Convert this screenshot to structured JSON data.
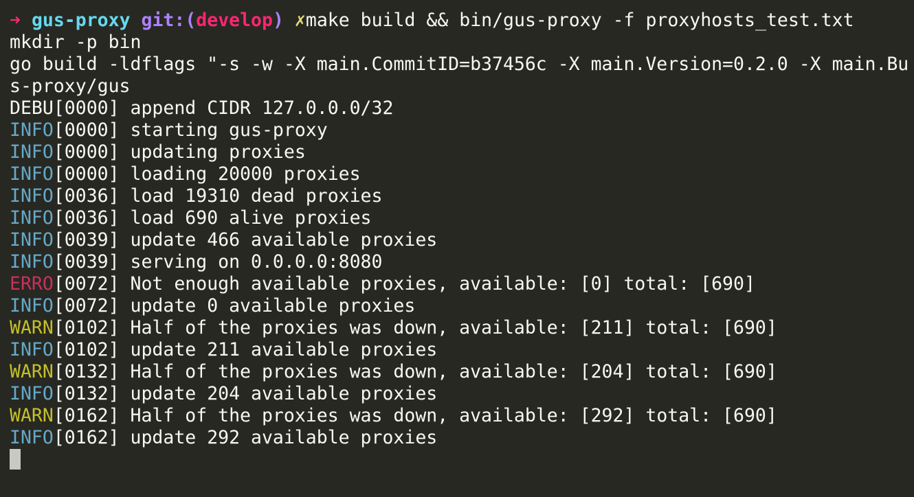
{
  "prompt": {
    "arrow": "➜",
    "directory": "gus-proxy",
    "git_prefix": "git:(",
    "branch": "develop",
    "git_suffix": ")",
    "dirty_mark": "✗",
    "command": "make build && bin/gus-proxy -f proxyhosts_test.txt"
  },
  "output": [
    "mkdir -p bin",
    "go build -ldflags \"-s -w -X main.CommitID=b37456c -X main.Version=0.2.0 -X main.Bu",
    "s-proxy/gus"
  ],
  "logs": [
    {
      "level": "DEBU",
      "ts": "[0000]",
      "msg": " append CIDR 127.0.0.0/32"
    },
    {
      "level": "INFO",
      "ts": "[0000]",
      "msg": " starting gus-proxy"
    },
    {
      "level": "INFO",
      "ts": "[0000]",
      "msg": " updating proxies"
    },
    {
      "level": "INFO",
      "ts": "[0000]",
      "msg": " loading 20000 proxies"
    },
    {
      "level": "INFO",
      "ts": "[0036]",
      "msg": " load 19310 dead proxies"
    },
    {
      "level": "INFO",
      "ts": "[0036]",
      "msg": " load 690 alive proxies"
    },
    {
      "level": "INFO",
      "ts": "[0039]",
      "msg": " update 466 available proxies"
    },
    {
      "level": "INFO",
      "ts": "[0039]",
      "msg": " serving on 0.0.0.0:8080"
    },
    {
      "level": "ERRO",
      "ts": "[0072]",
      "msg": " Not enough available proxies, available: [0] total: [690]"
    },
    {
      "level": "INFO",
      "ts": "[0072]",
      "msg": " update 0 available proxies"
    },
    {
      "level": "WARN",
      "ts": "[0102]",
      "msg": " Half of the proxies was down, available: [211] total: [690]"
    },
    {
      "level": "INFO",
      "ts": "[0102]",
      "msg": " update 211 available proxies"
    },
    {
      "level": "WARN",
      "ts": "[0132]",
      "msg": " Half of the proxies was down, available: [204] total: [690]"
    },
    {
      "level": "INFO",
      "ts": "[0132]",
      "msg": " update 204 available proxies"
    },
    {
      "level": "WARN",
      "ts": "[0162]",
      "msg": " Half of the proxies was down, available: [292] total: [690]"
    },
    {
      "level": "INFO",
      "ts": "[0162]",
      "msg": " update 292 available proxies"
    }
  ],
  "colors": {
    "background": "#272822",
    "foreground": "#f8f8f2",
    "info": "#66a9c9",
    "warn": "#c4c02a",
    "error": "#c9315d",
    "prompt_arrow": "#f92672",
    "prompt_dir": "#66d9ef",
    "prompt_git": "#ae81ff"
  }
}
